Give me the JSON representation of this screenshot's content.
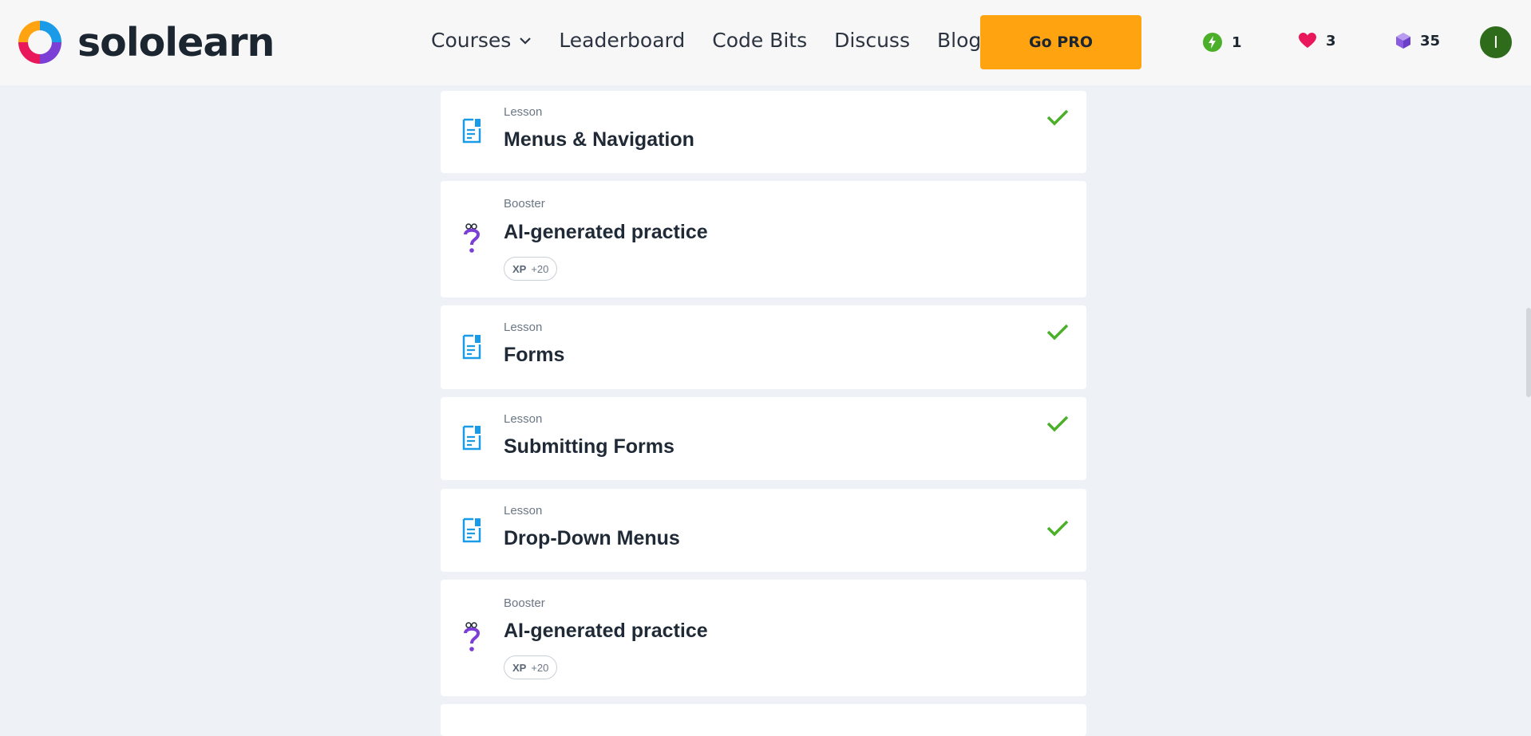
{
  "brand": {
    "name": "sololearn"
  },
  "nav": {
    "items": [
      {
        "label": "Courses",
        "has_dropdown": true
      },
      {
        "label": "Leaderboard"
      },
      {
        "label": "Code Bits"
      },
      {
        "label": "Discuss"
      },
      {
        "label": "Blog"
      }
    ]
  },
  "header": {
    "go_pro_label": "Go PRO",
    "streak": "1",
    "hearts": "3",
    "gems": "35",
    "avatar_initial": "I"
  },
  "colors": {
    "accent_orange": "#ffa310",
    "lesson_blue": "#1a9be8",
    "check_green": "#4caf2a",
    "booster_purple": "#7b3fd6",
    "heart_red": "#e8185a"
  },
  "lessons": [
    {
      "type": "Lesson",
      "title": "Menus & Navigation",
      "icon": "lesson-doc-icon",
      "completed": true
    },
    {
      "type": "Booster",
      "title": "AI-generated practice",
      "icon": "booster-question-icon",
      "xp_label": "XP",
      "xp_value": "+20"
    },
    {
      "type": "Lesson",
      "title": "Forms",
      "icon": "lesson-doc-icon",
      "completed": true
    },
    {
      "type": "Lesson",
      "title": "Submitting Forms",
      "icon": "lesson-doc-icon",
      "completed": true
    },
    {
      "type": "Lesson",
      "title": "Drop-Down Menus",
      "icon": "lesson-doc-icon",
      "completed": true
    },
    {
      "type": "Booster",
      "title": "AI-generated practice",
      "icon": "booster-question-icon",
      "xp_label": "XP",
      "xp_value": "+20"
    }
  ]
}
